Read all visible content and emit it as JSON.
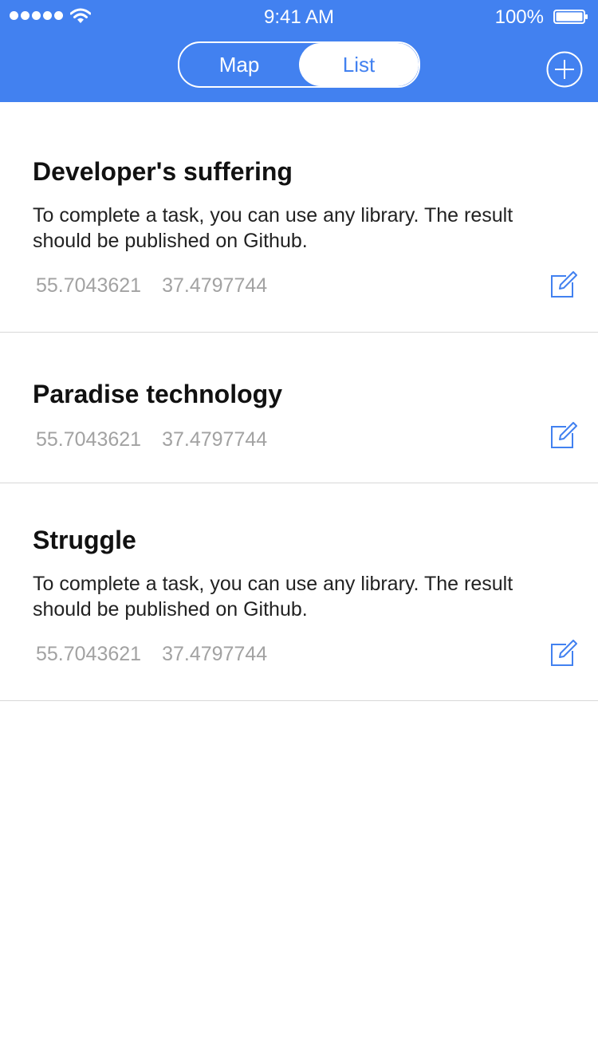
{
  "status_bar": {
    "time": "9:41 AM",
    "battery": "100%"
  },
  "nav": {
    "tabs": [
      {
        "label": "Map",
        "active": false
      },
      {
        "label": "List",
        "active": true
      }
    ],
    "add_icon": "plus-circle-icon"
  },
  "colors": {
    "accent": "#4281F0",
    "coords_text": "#a2a2a2"
  },
  "items": [
    {
      "title": "Developer's suffering",
      "description": "To complete a task, you can use any library. The result should be published on Github.",
      "latitude": "55.7043621",
      "longitude": "37.4797744",
      "edit_icon": "edit-icon"
    },
    {
      "title": "Paradise technology",
      "description": "",
      "latitude": "55.7043621",
      "longitude": "37.4797744",
      "edit_icon": "edit-icon"
    },
    {
      "title": "Struggle",
      "description": "To complete a task, you can use any library. The result should be published on Github.",
      "latitude": "55.7043621",
      "longitude": "37.4797744",
      "edit_icon": "edit-icon"
    }
  ]
}
